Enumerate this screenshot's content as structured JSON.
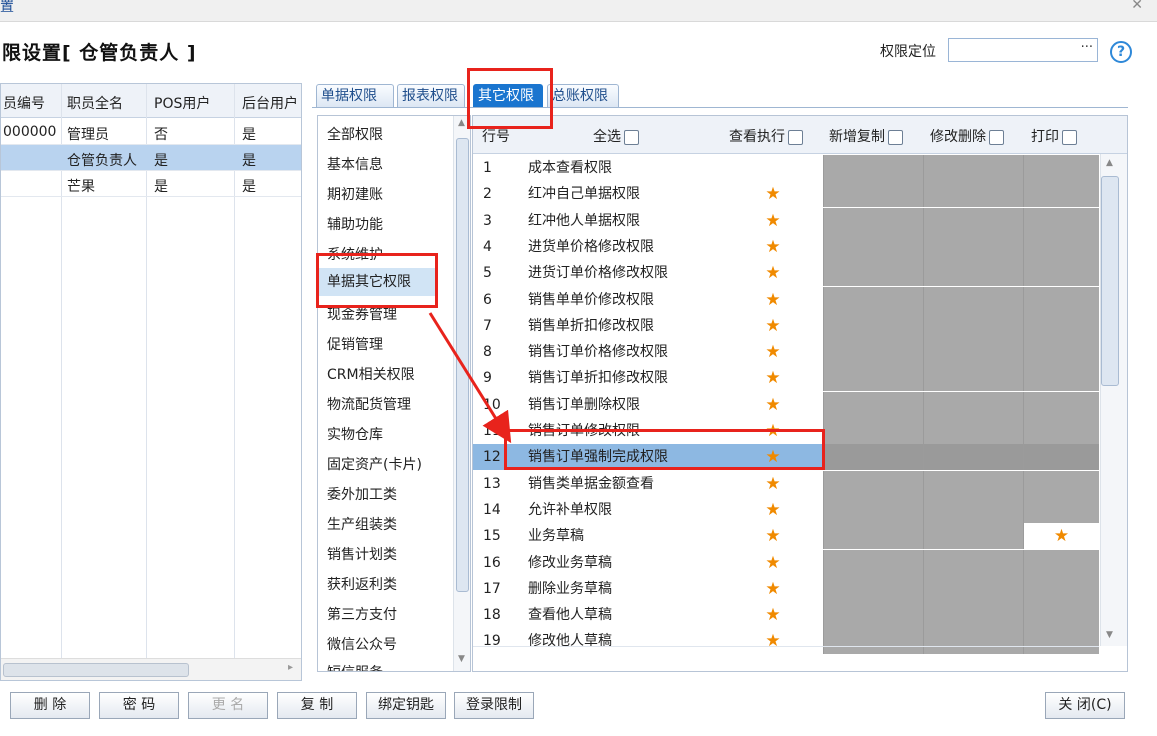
{
  "window": {
    "title_fragment": "置",
    "close_glyph": "✕"
  },
  "heading": "限设置[ 仓管负责人 ]",
  "locator": {
    "label": "权限定位",
    "value": "",
    "button_glyph": "···"
  },
  "help_glyph": "?",
  "left_table": {
    "columns": [
      "员编号",
      "职员全名",
      "POS用户",
      "后台用户"
    ],
    "rows": [
      {
        "id": "000000",
        "name": "管理员",
        "pos": "否",
        "backend": "是"
      },
      {
        "id": "",
        "name": "仓管负责人",
        "pos": "是",
        "backend": "是"
      },
      {
        "id": "",
        "name": "芒果",
        "pos": "是",
        "backend": "是"
      }
    ]
  },
  "tabs": [
    "单据权限",
    "报表权限",
    "其它权限",
    "总账权限"
  ],
  "active_tab": "其它权限",
  "categories": [
    "全部权限",
    "基本信息",
    "期初建账",
    "辅助功能",
    "系统维护",
    "单据其它权限",
    "现金券管理",
    "促销管理",
    "CRM相关权限",
    "物流配货管理",
    "实物仓库",
    "固定资产(卡片)",
    "委外加工类",
    "生产组装类",
    "销售计划类",
    "获利返利类",
    "第三方支付",
    "微信公众号",
    "短信服务"
  ],
  "selected_category": "单据其它权限",
  "perm_table": {
    "columns": {
      "num": "行号",
      "select_all": "全选",
      "view": "查看执行",
      "copy": "新增复制",
      "edit": "修改删除",
      "print": "打印"
    },
    "star": "★",
    "rows": [
      {
        "num": "1",
        "name": "成本查看权限",
        "view": false,
        "print": false
      },
      {
        "num": "2",
        "name": "红冲自己单据权限",
        "view": true,
        "print": false
      },
      {
        "num": "3",
        "name": "红冲他人单据权限",
        "view": true,
        "print": false
      },
      {
        "num": "4",
        "name": "进货单价格修改权限",
        "view": true,
        "print": false
      },
      {
        "num": "5",
        "name": "进货订单价格修改权限",
        "view": true,
        "print": false
      },
      {
        "num": "6",
        "name": "销售单单价修改权限",
        "view": true,
        "print": false
      },
      {
        "num": "7",
        "name": "销售单折扣修改权限",
        "view": true,
        "print": false
      },
      {
        "num": "8",
        "name": "销售订单价格修改权限",
        "view": true,
        "print": false
      },
      {
        "num": "9",
        "name": "销售订单折扣修改权限",
        "view": true,
        "print": false
      },
      {
        "num": "10",
        "name": "销售订单删除权限",
        "view": true,
        "print": false
      },
      {
        "num": "11",
        "name": "销售订单修改权限",
        "view": true,
        "print": false
      },
      {
        "num": "12",
        "name": "销售订单强制完成权限",
        "view": true,
        "print": false
      },
      {
        "num": "13",
        "name": "销售类单据金额查看",
        "view": true,
        "print": false
      },
      {
        "num": "14",
        "name": "允许补单权限",
        "view": true,
        "print": false
      },
      {
        "num": "15",
        "name": "业务草稿",
        "view": true,
        "print": true
      },
      {
        "num": "16",
        "name": "修改业务草稿",
        "view": true,
        "print": false
      },
      {
        "num": "17",
        "name": "删除业务草稿",
        "view": true,
        "print": false
      },
      {
        "num": "18",
        "name": "查看他人草稿",
        "view": true,
        "print": false
      },
      {
        "num": "19",
        "name": "修改他人草稿",
        "view": true,
        "print": false
      }
    ],
    "selected_row": "12"
  },
  "buttons": {
    "delete": "删 除",
    "password": "密 码",
    "rename": "更 名",
    "copy": "复 制",
    "bind_key": "绑定钥匙",
    "login_limit": "登录限制",
    "close": "关 闭(C)"
  },
  "colors": {
    "annotation": "#e8231c",
    "star": "#f08a00",
    "active_tab": "#1a75cf",
    "disabled_cell": "#a9a9a9"
  }
}
